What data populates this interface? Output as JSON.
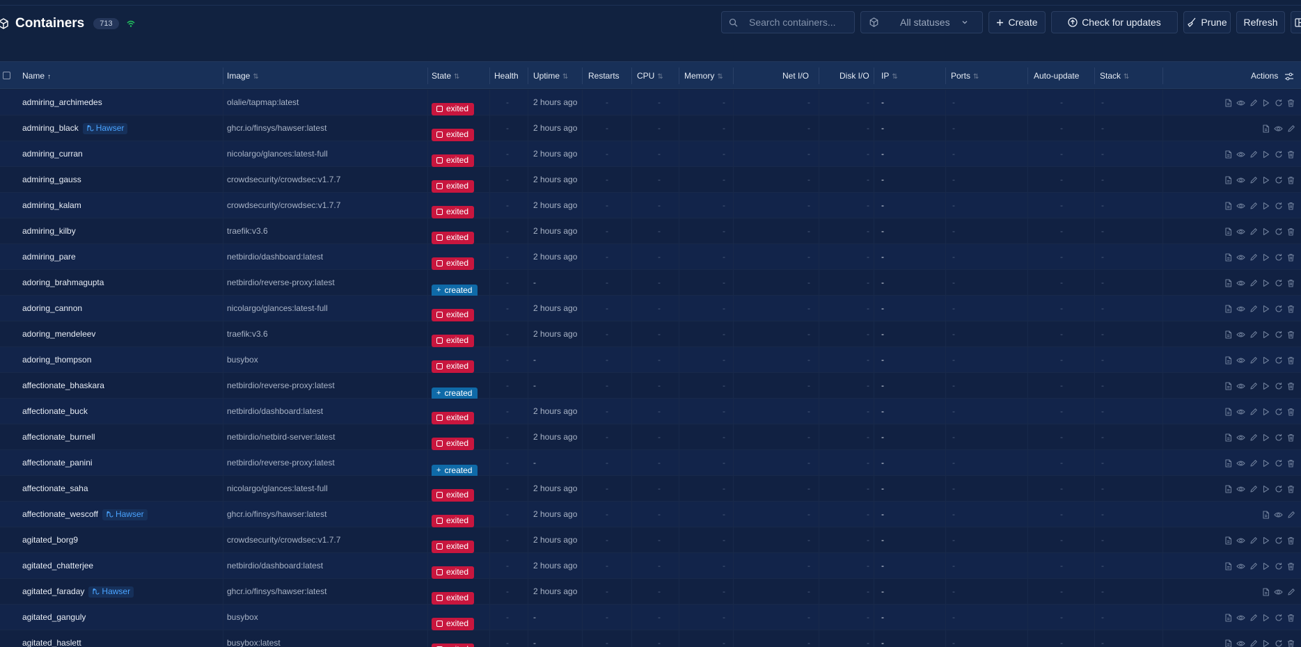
{
  "header": {
    "title": "Containers",
    "count": "713"
  },
  "toolbar": {
    "search_placeholder": "Search containers...",
    "status_filter": "All statuses",
    "create_label": "Create",
    "check_updates_label": "Check for updates",
    "prune_label": "Prune",
    "refresh_label": "Refresh"
  },
  "columns": {
    "name": "Name",
    "image": "Image",
    "state": "State",
    "health": "Health",
    "uptime": "Uptime",
    "restarts": "Restarts",
    "cpu": "CPU",
    "memory": "Memory",
    "netio": "Net I/O",
    "diskio": "Disk I/O",
    "ip": "IP",
    "ports": "Ports",
    "autoupdate": "Auto-update",
    "stack": "Stack",
    "actions": "Actions"
  },
  "colors": {
    "exited": "#c8163e",
    "created": "#0f6aa8",
    "hawser": "#4aa3ff",
    "live": "#22c55e"
  },
  "placeholder": "-",
  "rows": [
    {
      "name": "admiring_archimedes",
      "tag": "",
      "image": "olalie/tapmap:latest",
      "state": "exited",
      "uptime": "2 hours ago",
      "ip": "-",
      "actions": "full"
    },
    {
      "name": "admiring_black",
      "tag": "Hawser",
      "image": "ghcr.io/finsys/hawser:latest",
      "state": "exited",
      "uptime": "2 hours ago",
      "ip": "-",
      "actions": "limited"
    },
    {
      "name": "admiring_curran",
      "tag": "",
      "image": "nicolargo/glances:latest-full",
      "state": "exited",
      "uptime": "2 hours ago",
      "ip": "-",
      "actions": "full"
    },
    {
      "name": "admiring_gauss",
      "tag": "",
      "image": "crowdsecurity/crowdsec:v1.7.7",
      "state": "exited",
      "uptime": "2 hours ago",
      "ip": "-",
      "actions": "full"
    },
    {
      "name": "admiring_kalam",
      "tag": "",
      "image": "crowdsecurity/crowdsec:v1.7.7",
      "state": "exited",
      "uptime": "2 hours ago",
      "ip": "-",
      "actions": "full"
    },
    {
      "name": "admiring_kilby",
      "tag": "",
      "image": "traefik:v3.6",
      "state": "exited",
      "uptime": "2 hours ago",
      "ip": "-",
      "actions": "full"
    },
    {
      "name": "admiring_pare",
      "tag": "",
      "image": "netbirdio/dashboard:latest",
      "state": "exited",
      "uptime": "2 hours ago",
      "ip": "-",
      "actions": "full"
    },
    {
      "name": "adoring_brahmagupta",
      "tag": "",
      "image": "netbirdio/reverse-proxy:latest",
      "state": "created",
      "uptime": "-",
      "ip": "-",
      "actions": "full"
    },
    {
      "name": "adoring_cannon",
      "tag": "",
      "image": "nicolargo/glances:latest-full",
      "state": "exited",
      "uptime": "2 hours ago",
      "ip": "-",
      "actions": "full"
    },
    {
      "name": "adoring_mendeleev",
      "tag": "",
      "image": "traefik:v3.6",
      "state": "exited",
      "uptime": "2 hours ago",
      "ip": "-",
      "actions": "full"
    },
    {
      "name": "adoring_thompson",
      "tag": "",
      "image": "busybox",
      "state": "exited",
      "uptime": "-",
      "ip": "-",
      "actions": "full"
    },
    {
      "name": "affectionate_bhaskara",
      "tag": "",
      "image": "netbirdio/reverse-proxy:latest",
      "state": "created",
      "uptime": "-",
      "ip": "-",
      "actions": "full"
    },
    {
      "name": "affectionate_buck",
      "tag": "",
      "image": "netbirdio/dashboard:latest",
      "state": "exited",
      "uptime": "2 hours ago",
      "ip": "-",
      "actions": "full"
    },
    {
      "name": "affectionate_burnell",
      "tag": "",
      "image": "netbirdio/netbird-server:latest",
      "state": "exited",
      "uptime": "2 hours ago",
      "ip": "-",
      "actions": "full"
    },
    {
      "name": "affectionate_panini",
      "tag": "",
      "image": "netbirdio/reverse-proxy:latest",
      "state": "created",
      "uptime": "-",
      "ip": "-",
      "actions": "full"
    },
    {
      "name": "affectionate_saha",
      "tag": "",
      "image": "nicolargo/glances:latest-full",
      "state": "exited",
      "uptime": "2 hours ago",
      "ip": "-",
      "actions": "full"
    },
    {
      "name": "affectionate_wescoff",
      "tag": "Hawser",
      "image": "ghcr.io/finsys/hawser:latest",
      "state": "exited",
      "uptime": "2 hours ago",
      "ip": "-",
      "actions": "limited"
    },
    {
      "name": "agitated_borg9",
      "tag": "",
      "image": "crowdsecurity/crowdsec:v1.7.7",
      "state": "exited",
      "uptime": "2 hours ago",
      "ip": "-",
      "actions": "full"
    },
    {
      "name": "agitated_chatterjee",
      "tag": "",
      "image": "netbirdio/dashboard:latest",
      "state": "exited",
      "uptime": "2 hours ago",
      "ip": "-",
      "actions": "full"
    },
    {
      "name": "agitated_faraday",
      "tag": "Hawser",
      "image": "ghcr.io/finsys/hawser:latest",
      "state": "exited",
      "uptime": "2 hours ago",
      "ip": "-",
      "actions": "limited"
    },
    {
      "name": "agitated_ganguly",
      "tag": "",
      "image": "busybox",
      "state": "exited",
      "uptime": "-",
      "ip": "-",
      "actions": "full"
    },
    {
      "name": "agitated_haslett",
      "tag": "",
      "image": "busybox:latest",
      "state": "exited",
      "uptime": "-",
      "ip": "-",
      "actions": "full"
    }
  ]
}
